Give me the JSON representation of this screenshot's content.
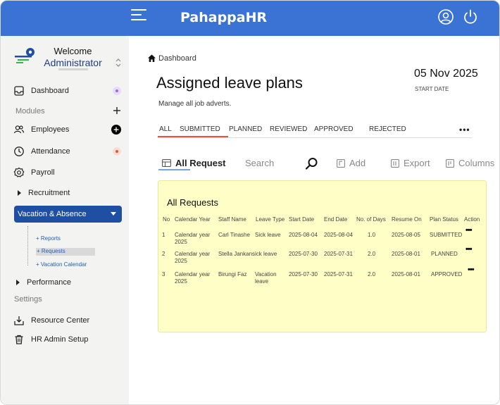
{
  "header": {
    "brand": "PahappaHR",
    "icons": [
      "hamburger-icon",
      "user-circle-icon",
      "power-icon"
    ],
    "color": "#3a73d4"
  },
  "sidebar": {
    "welcome": "Welcome",
    "role": "Administrator",
    "dashboard": "Dashboard",
    "modules_label": "Modules",
    "items": [
      {
        "label": "Employees",
        "icon": "users-icon"
      },
      {
        "label": "Attendance",
        "icon": "clock-icon"
      },
      {
        "label": "Payroll",
        "icon": "gear-icon"
      },
      {
        "label": "Recruitment",
        "icon": "caret-right-icon"
      }
    ],
    "active": "Vacation & Absence",
    "subitems": [
      "Reports",
      "Requests",
      "Vacation Calendar"
    ],
    "performance": "Performance",
    "settings_label": "Settings",
    "resource_center": "Resource Center",
    "hr_admin": "HR Admin Setup"
  },
  "page": {
    "breadcrumb": "Dashboard",
    "title": "Assigned leave plans",
    "subtitle": "Manage all job adverts.",
    "date": "05 Nov 2025",
    "date_label": "START DATE"
  },
  "tabs": [
    "ALL",
    "SUBMITTED",
    "PLANNED",
    "REVIEWED",
    "APPROVED",
    "REJECTED"
  ],
  "more": "•••",
  "toolbar": {
    "all_request": "All Request",
    "search_placeholder": "Search",
    "add": "Add",
    "export": "Export",
    "columns": "Columns"
  },
  "table": {
    "title": "All Requests",
    "columns": [
      "No",
      "Calendar Year",
      "Staff Name",
      "Leave Type",
      "Start Date",
      "End Date",
      "No. of Days",
      "Resume On",
      "Plan Status",
      "Action"
    ],
    "rows": [
      {
        "no": "1",
        "year1": "Calendar year",
        "year2": "2025",
        "staff": "Carl Tinashe",
        "leave1": "Sick leave",
        "leave2": "",
        "start": "2025-08-04",
        "end": "2025-08-04",
        "days": "1.0",
        "resume": "2025-08-05",
        "status": "SUBMITTED",
        "action": "•••"
      },
      {
        "no": "2",
        "year1": "Calendar year",
        "year2": "2025",
        "staff": "Stella Jankansick leave",
        "leave1": "",
        "leave2": "",
        "start": "2025-07-30",
        "end": "2025-07-31",
        "days": "2.0",
        "resume": "2025-08-01",
        "status": "PLANNED",
        "action": "•••"
      },
      {
        "no": "3",
        "year1": "Calendar year",
        "year2": "2025",
        "staff": "Birungi Faz",
        "leave1": "Vacation",
        "leave2": "leave",
        "start": "2025-07-30",
        "end": "2025-07-31",
        "days": "2.0",
        "resume": "2025-08-01",
        "status": "APPROVED",
        "action": "•••"
      }
    ]
  }
}
